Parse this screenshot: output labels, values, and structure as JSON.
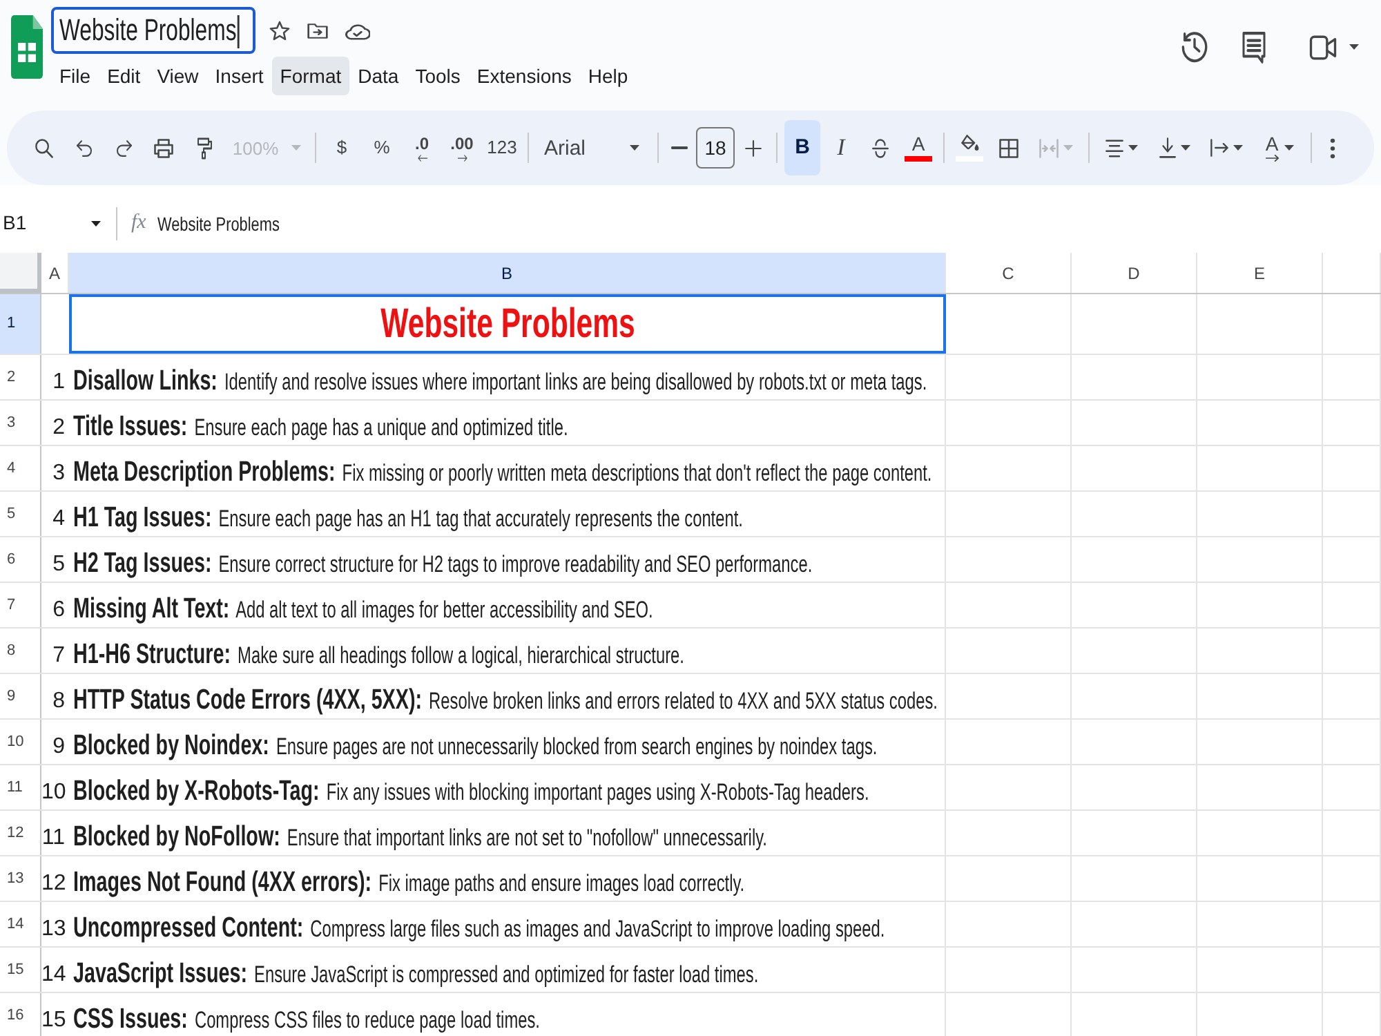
{
  "document": {
    "title": "Website Problems",
    "editing": true
  },
  "menu": [
    {
      "label": "File",
      "highlighted": false
    },
    {
      "label": "Edit",
      "highlighted": false
    },
    {
      "label": "View",
      "highlighted": false
    },
    {
      "label": "Insert",
      "highlighted": false
    },
    {
      "label": "Format",
      "highlighted": true
    },
    {
      "label": "Data",
      "highlighted": false
    },
    {
      "label": "Tools",
      "highlighted": false
    },
    {
      "label": "Extensions",
      "highlighted": false
    },
    {
      "label": "Help",
      "highlighted": false
    }
  ],
  "toolbar": {
    "groups": [
      [
        {
          "kind": "search",
          "disabled": false
        },
        {
          "kind": "undo",
          "disabled": false
        },
        {
          "kind": "redo",
          "disabled": false
        },
        {
          "kind": "print",
          "disabled": false
        },
        {
          "kind": "paintformat",
          "disabled": false
        },
        {
          "kind": "zoom",
          "label": "100%",
          "disabled": true
        }
      ],
      [
        {
          "kind": "text",
          "label": "$"
        },
        {
          "kind": "text",
          "label": "%"
        },
        {
          "kind": "decrease",
          "label": ".0"
        },
        {
          "kind": "increase",
          "label": ".00"
        },
        {
          "kind": "text",
          "label": "123"
        }
      ],
      [
        {
          "kind": "font",
          "label": "Arial"
        }
      ],
      [
        {
          "kind": "minus"
        },
        {
          "kind": "size",
          "value": "18"
        },
        {
          "kind": "plus"
        }
      ],
      [
        {
          "kind": "bold",
          "label": "B",
          "active": true
        },
        {
          "kind": "italic",
          "label": "I",
          "active": false
        },
        {
          "kind": "strike",
          "active": false
        },
        {
          "kind": "textcolor",
          "label": "A",
          "color": "#ff0000",
          "active": false
        }
      ],
      [
        {
          "kind": "fillcolor",
          "color": "#ffffff",
          "disabled": false
        },
        {
          "kind": "borders",
          "disabled": false
        },
        {
          "kind": "merge",
          "disabled": true
        }
      ],
      [
        {
          "kind": "halign"
        },
        {
          "kind": "valign"
        },
        {
          "kind": "wrap"
        },
        {
          "kind": "rotate",
          "label": "A"
        }
      ],
      [
        {
          "kind": "more"
        }
      ]
    ]
  },
  "formula_bar": {
    "cell_ref": "B1",
    "function_label": "fx",
    "formula": "Website Problems"
  },
  "grid": {
    "columns": [
      {
        "label": "A",
        "selected": false
      },
      {
        "label": "B",
        "selected": true
      },
      {
        "label": "C",
        "selected": false
      },
      {
        "label": "D",
        "selected": false
      },
      {
        "label": "E",
        "selected": false
      }
    ],
    "rows": [
      {
        "header": "1",
        "selected": true,
        "kind": "title",
        "b": "Website Problems"
      },
      {
        "header": "2",
        "selected": false,
        "kind": "item",
        "a": "1",
        "b": "**Disallow Links:** Identify and resolve issues where important links are being disallowed by robots.txt or meta tags."
      },
      {
        "header": "3",
        "selected": false,
        "kind": "item",
        "a": "2",
        "b": "**Title Issues:** Ensure each page has a unique and optimized title."
      },
      {
        "header": "4",
        "selected": false,
        "kind": "item",
        "a": "3",
        "b": "**Meta Description Problems:** Fix missing or poorly written meta descriptions that don't reflect the page content."
      },
      {
        "header": "5",
        "selected": false,
        "kind": "item",
        "a": "4",
        "b": "**H1 Tag Issues:** Ensure each page has an H1 tag that accurately represents the content."
      },
      {
        "header": "6",
        "selected": false,
        "kind": "item",
        "a": "5",
        "b": "**H2 Tag Issues:** Ensure correct structure for H2 tags to improve readability and SEO performance."
      },
      {
        "header": "7",
        "selected": false,
        "kind": "item",
        "a": "6",
        "b": "**Missing Alt Text:** Add alt text to all images for better accessibility and SEO."
      },
      {
        "header": "8",
        "selected": false,
        "kind": "item",
        "a": "7",
        "b": "**H1-H6 Structure:** Make sure all headings follow a logical, hierarchical structure."
      },
      {
        "header": "9",
        "selected": false,
        "kind": "item",
        "a": "8",
        "b": "**HTTP Status Code Errors (4XX, 5XX):** Resolve broken links and errors related to 4XX and 5XX status codes."
      },
      {
        "header": "10",
        "selected": false,
        "kind": "item",
        "a": "9",
        "b": "**Blocked by Noindex:** Ensure pages are not unnecessarily blocked from search engines by noindex tags."
      },
      {
        "header": "11",
        "selected": false,
        "kind": "item",
        "a": "10",
        "b": "**Blocked by X-Robots-Tag:** Fix any issues with blocking important pages using X-Robots-Tag headers."
      },
      {
        "header": "12",
        "selected": false,
        "kind": "item",
        "a": "11",
        "b": "**Blocked by NoFollow:** Ensure that important links are not set to \"nofollow\" unnecessarily."
      },
      {
        "header": "13",
        "selected": false,
        "kind": "item",
        "a": "12",
        "b": "**Images Not Found (4XX errors):** Fix image paths and ensure images load correctly."
      },
      {
        "header": "14",
        "selected": false,
        "kind": "item",
        "a": "13",
        "b": "**Uncompressed Content:** Compress large files such as images and JavaScript to improve loading speed."
      },
      {
        "header": "15",
        "selected": false,
        "kind": "item",
        "a": "14",
        "b": "**JavaScript Issues:** Ensure JavaScript is compressed and optimized for faster load times."
      },
      {
        "header": "16",
        "selected": false,
        "kind": "item",
        "a": "15",
        "b": "**CSS Issues:** Compress CSS files to reduce page load times."
      }
    ]
  }
}
